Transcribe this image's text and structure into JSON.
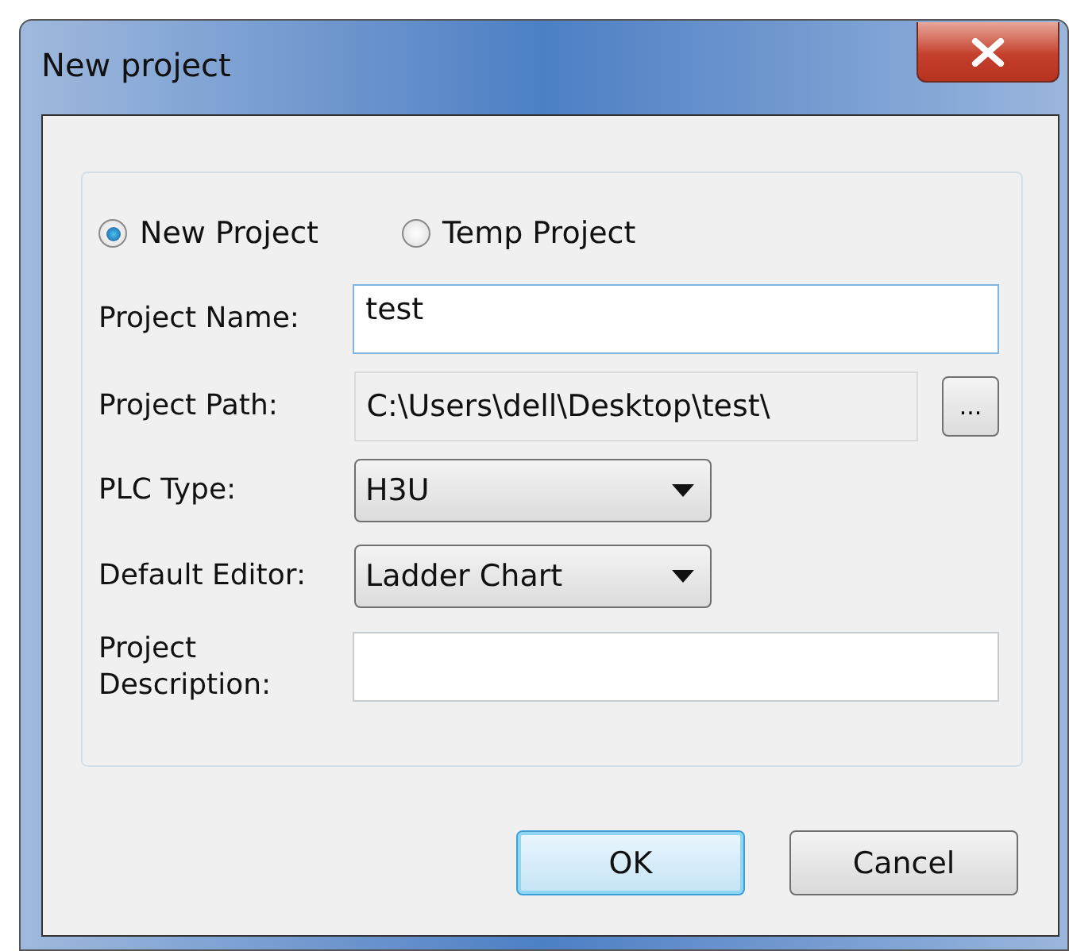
{
  "window": {
    "title": "New project"
  },
  "project_type": [
    {
      "label": "New Project",
      "selected": true
    },
    {
      "label": "Temp Project",
      "selected": false
    }
  ],
  "fields": [
    {
      "kind": "text",
      "label": "Project Name:",
      "value": "test",
      "focused": true
    },
    {
      "kind": "path",
      "label": "Project Path:",
      "value": "C:\\Users\\dell\\Desktop\\test\\",
      "button": "..."
    },
    {
      "kind": "combo",
      "label": "PLC Type:",
      "value": "H3U"
    },
    {
      "kind": "combo",
      "label": "Default Editor:",
      "value": "Ladder Chart"
    },
    {
      "kind": "text",
      "label": "Project Description:",
      "focused": false
    }
  ],
  "buttons": [
    {
      "label": "OK",
      "default": true
    },
    {
      "label": "Cancel",
      "default": false
    }
  ]
}
